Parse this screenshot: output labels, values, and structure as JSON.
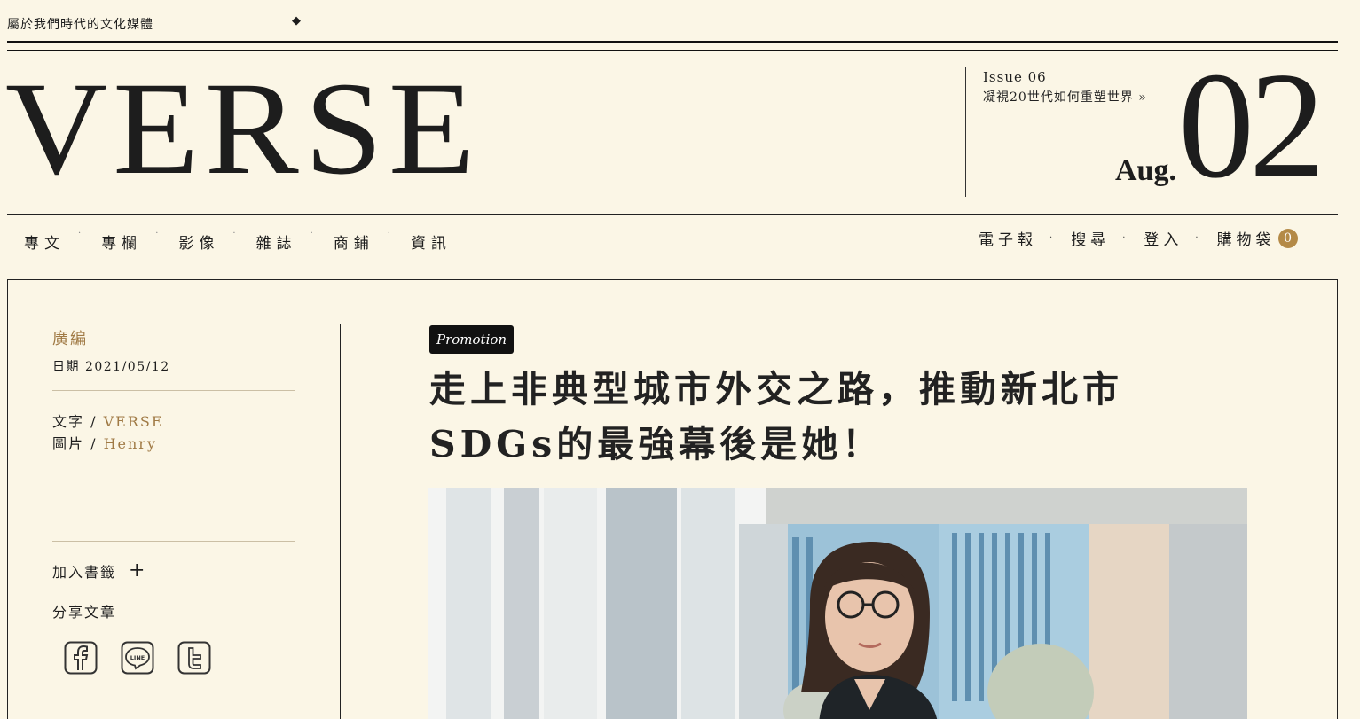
{
  "header": {
    "slogan": "屬於我們時代的文化媒體",
    "diamond": "◆",
    "logo": "VERSE",
    "issue_label": "Issue 06",
    "issue_link": "凝視20世代如何重塑世界 »",
    "date_month": "Aug.",
    "date_day": "02"
  },
  "nav": {
    "left": [
      "專文",
      "專欄",
      "影像",
      "雜誌",
      "商鋪",
      "資訊"
    ],
    "right": [
      "電子報",
      "搜尋",
      "登入",
      "購物袋"
    ],
    "cart_count": "0",
    "separator": "·"
  },
  "sidebar": {
    "category": "廣編",
    "date": "日期 2021/05/12",
    "writer_label": "文字 / ",
    "writer_name": "VERSE",
    "photo_label": "圖片 / ",
    "photo_name": "Henry",
    "bookmark": "加入書籤",
    "bookmark_icon": "plus-icon",
    "share": "分享文章",
    "social_icons": [
      "facebook-icon",
      "line-icon",
      "twitter-icon"
    ]
  },
  "article": {
    "tag": "Promotion",
    "title_line1": "走上非典型城市外交之路，推動新北市",
    "title_line2": "SDGs的最強幕後是她！"
  },
  "colors": {
    "background": "#fbf6e6",
    "accent_gold": "#a07a45",
    "badge": "#b48a47",
    "ink": "#1d1d1d"
  }
}
